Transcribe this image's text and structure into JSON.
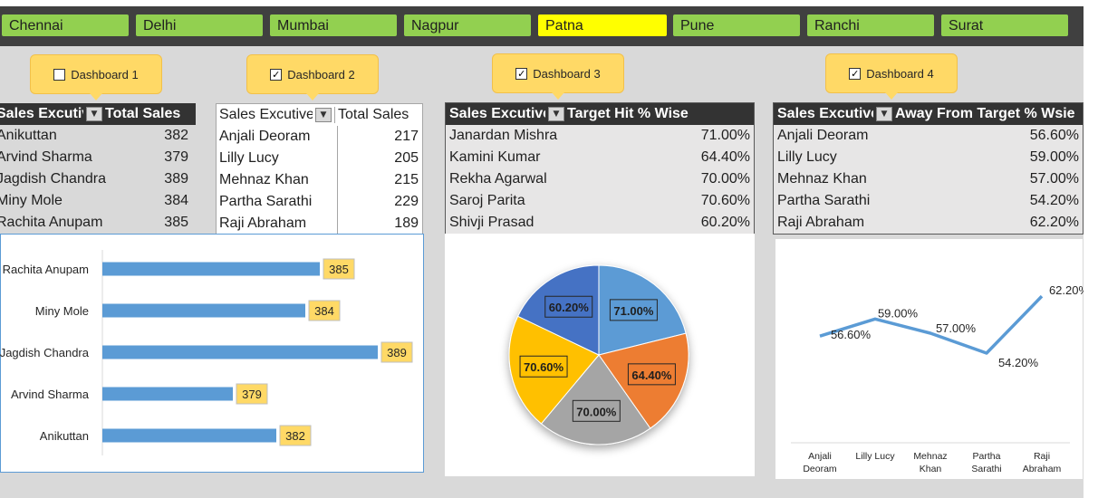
{
  "tabs": [
    "Chennai",
    "Delhi",
    "Mumbai",
    "Nagpur",
    "Patna",
    "Pune",
    "Ranchi",
    "Surat"
  ],
  "selected_tab": "Patna",
  "dashboards": [
    {
      "label": "Dashboard 1",
      "checked": false,
      "check": ""
    },
    {
      "label": "Dashboard 2",
      "checked": true,
      "check": "✓"
    },
    {
      "label": "Dashboard 3",
      "checked": true,
      "check": "✓"
    },
    {
      "label": "Dashboard 4",
      "checked": true,
      "check": "✓"
    }
  ],
  "filter_icon": "funnel-filter-icon",
  "table1": {
    "headers": [
      "Sales Excutive",
      "Total Sales"
    ],
    "rows": [
      [
        "Anikuttan",
        "382"
      ],
      [
        "Arvind Sharma",
        "379"
      ],
      [
        "Jagdish Chandra",
        "389"
      ],
      [
        "Miny Mole",
        "384"
      ],
      [
        "Rachita Anupam",
        "385"
      ]
    ]
  },
  "table2": {
    "headers": [
      "Sales Excutive",
      "Total Sales"
    ],
    "rows": [
      [
        "Anjali Deoram",
        "217"
      ],
      [
        "Lilly Lucy",
        "205"
      ],
      [
        "Mehnaz Khan",
        "215"
      ],
      [
        "Partha Sarathi",
        "229"
      ],
      [
        "Raji Abraham",
        "189"
      ]
    ]
  },
  "table3": {
    "headers": [
      "Sales Excutive",
      "Target Hit % Wise"
    ],
    "rows": [
      [
        "Janardan Mishra",
        "71.00%"
      ],
      [
        "Kamini Kumar",
        "64.40%"
      ],
      [
        "Rekha Agarwal",
        "70.00%"
      ],
      [
        "Saroj Parita",
        "70.60%"
      ],
      [
        "Shivji Prasad",
        "60.20%"
      ]
    ]
  },
  "table4": {
    "headers": [
      "Sales Excutive",
      "Away From Target % Wsie"
    ],
    "rows": [
      [
        "Anjali Deoram",
        "56.60%"
      ],
      [
        "Lilly Lucy",
        "59.00%"
      ],
      [
        "Mehnaz Khan",
        "57.00%"
      ],
      [
        "Partha Sarathi",
        "54.20%"
      ],
      [
        "Raji Abraham",
        "62.20%"
      ]
    ]
  },
  "colors": {
    "tab": "#92d050",
    "tab_selected": "#ffff00",
    "bar": "#5b9bd5",
    "label_bg": "#ffd966",
    "header": "#333333"
  },
  "chart_data": [
    {
      "type": "bar",
      "orientation": "horizontal",
      "categories": [
        "Rachita Anupam",
        "Miny Mole",
        "Jagdish Chandra",
        "Arvind Sharma",
        "Anikuttan"
      ],
      "values": [
        385,
        384,
        389,
        379,
        382
      ],
      "labels": [
        "385",
        "384",
        "389",
        "379",
        "382"
      ],
      "xlim": [
        370,
        390
      ]
    },
    {
      "type": "pie",
      "categories": [
        "Janardan Mishra",
        "Kamini Kumar",
        "Rekha Agarwal",
        "Saroj Parita",
        "Shivji Prasad"
      ],
      "values": [
        71.0,
        64.4,
        70.0,
        70.6,
        60.2
      ],
      "labels": [
        "71.00%",
        "64.40%",
        "70.00%",
        "70.60%",
        "60.20%"
      ],
      "colors": [
        "#5b9bd5",
        "#ed7d31",
        "#a5a5a5",
        "#ffc000",
        "#4472c4"
      ]
    },
    {
      "type": "line",
      "categories": [
        [
          "Anjali",
          "Deoram"
        ],
        [
          "Lilly Lucy"
        ],
        [
          "Mehnaz",
          "Khan"
        ],
        [
          "Partha",
          "Sarathi"
        ],
        [
          "Raji",
          "Abraham"
        ]
      ],
      "values": [
        56.6,
        59.0,
        57.0,
        54.2,
        62.2
      ],
      "labels": [
        "56.60%",
        "59.00%",
        "57.00%",
        "54.20%",
        "62.20%"
      ],
      "ylim": [
        50,
        64
      ]
    }
  ]
}
